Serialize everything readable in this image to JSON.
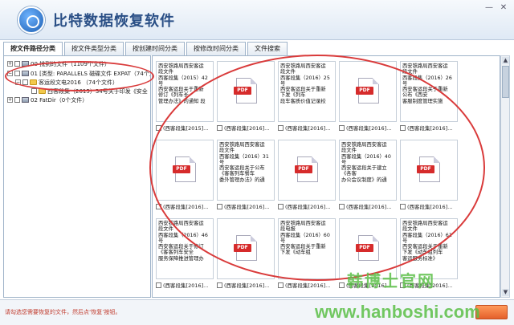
{
  "app": {
    "title": "比特数据恢复软件",
    "win_min": "—",
    "win_close": "✕"
  },
  "tabs": [
    {
      "label": "按文件路径分类",
      "active": true
    },
    {
      "label": "按文件类型分类"
    },
    {
      "label": "按创建时间分类"
    },
    {
      "label": "按修改时间分类"
    },
    {
      "label": "文件搜索"
    }
  ],
  "tree": [
    {
      "label": "00 找到的文件（1109个文件）"
    },
    {
      "label": "01 [类型: PARALLELS 磁碟文件 EXPAT（74个文件）"
    },
    {
      "label": "客运段文电2016  （74个文件）"
    },
    {
      "label": "西客段集（2015）34号关于印发《安全"
    },
    {
      "label": "02 FatDir（0个文件）"
    }
  ],
  "cards": [
    {
      "type": "text",
      "text": "西安铁路局西安客运\n段文件\n西客段集（2015）42\n号\n西安客运段关于重新\n修订《列车长\n管理办法》的通知 段",
      "caption": "(西客段集[2015]..."
    },
    {
      "type": "pdf",
      "caption": "(西客段集[2016]..."
    },
    {
      "type": "text",
      "text": "西安铁路局西安客运\n段文件\n西客段集（2016）25\n号\n西安客运段关于重新\n下发《列车\n段车客质价值记录校",
      "caption": "(西客段集[2016]..."
    },
    {
      "type": "pdf",
      "caption": "(西客段集[2016]..."
    },
    {
      "type": "text",
      "text": "西安铁路局西安客运\n段文件\n西客段集（2016）26\n号\n西安客运段关于重新\n公布《西安\n客服制度管理实施",
      "caption": "(西客段集[2016]..."
    },
    {
      "type": "pdf",
      "caption": "(西客段集[2016]..."
    },
    {
      "type": "text",
      "text": "西安铁路局西安客运\n段文件\n西客段集（2016）31\n号\n西安客运段关于公布\n《客客列车餐车\n委外管理办法》的通",
      "caption": "(西客段集[2016]..."
    },
    {
      "type": "pdf",
      "caption": "(西客段集[2016]..."
    },
    {
      "type": "text",
      "text": "西安铁路局西安客运\n段文件\n西客段集（2016）40\n号\n西安客运段关于建立\n《各客\n办公会议制度》的通",
      "caption": "(西客段集[2016]..."
    },
    {
      "type": "pdf",
      "caption": "(西客段集[2016]..."
    },
    {
      "type": "text",
      "text": "西安铁路局西安客运\n段文件\n西客段集（2016）46\n号\n西安客运段关于修订\n《客客列车安全\n服务保障推进管理办",
      "caption": "(西客段集[2016]..."
    },
    {
      "type": "pdf",
      "caption": "(西客段集[2016]..."
    },
    {
      "type": "text",
      "text": "西安铁路局西安客运\n段电报\n西客段集（2016）60\n号\n西安客运段关于重新\n下发《动车组",
      "caption": "(西客段集[2016]..."
    },
    {
      "type": "pdf",
      "caption": "(西客段集[2016]..."
    },
    {
      "type": "text",
      "text": "西安铁路局西安客运\n段文件\n西客段集（2016）61\n号\n西安客运段关于重新\n下发《动车组列车\n客运服务标准》",
      "caption": "(西客段集[2016]..."
    }
  ],
  "status": {
    "hint": "请勾选您需要恢复的文件，然后点‘恢复’按钮。"
  },
  "watermark": {
    "cn": "韩博士官网",
    "url": "www.hanboshi.com"
  },
  "pdf_label": "PDF"
}
